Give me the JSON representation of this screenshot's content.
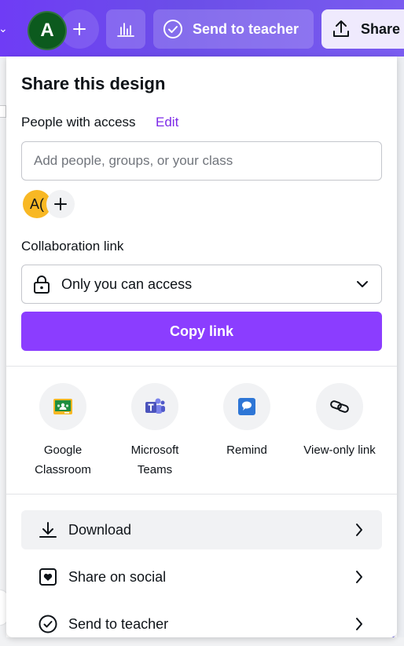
{
  "topbar": {
    "avatar_initial": "A",
    "add_icon": "plus-icon",
    "chart_icon": "bar-chart-icon",
    "send_to_teacher_label": "Send to teacher",
    "share_label": "Share"
  },
  "panel": {
    "title": "Share this design",
    "people_with_access_label": "People with access",
    "edit_label": "Edit",
    "people_input_placeholder": "Add people, groups, or your class",
    "member_avatar_text": "A(",
    "collaboration_link_label": "Collaboration link",
    "access_select_value": "Only you can access",
    "copy_link_label": "Copy link",
    "share_options": [
      {
        "label_line1": "Google",
        "label_line2": "Classroom",
        "icon": "google-classroom-icon"
      },
      {
        "label_line1": "Microsoft",
        "label_line2": "Teams",
        "icon": "microsoft-teams-icon"
      },
      {
        "label_line1": "Remind",
        "label_line2": "",
        "icon": "remind-icon"
      },
      {
        "label_line1": "View-only link",
        "label_line2": "",
        "icon": "link-icon"
      }
    ],
    "actions": [
      {
        "label": "Download",
        "icon": "download-icon"
      },
      {
        "label": "Share on social",
        "icon": "heart-icon"
      },
      {
        "label": "Send to teacher",
        "icon": "check-circle-icon"
      }
    ]
  },
  "colors": {
    "accent": "#8b3dff",
    "edit_link": "#7d2ae8",
    "topbar_start": "#6f3cf5",
    "avatar_green": "#0c5a1e",
    "avatar_yellow": "#f8b824"
  }
}
